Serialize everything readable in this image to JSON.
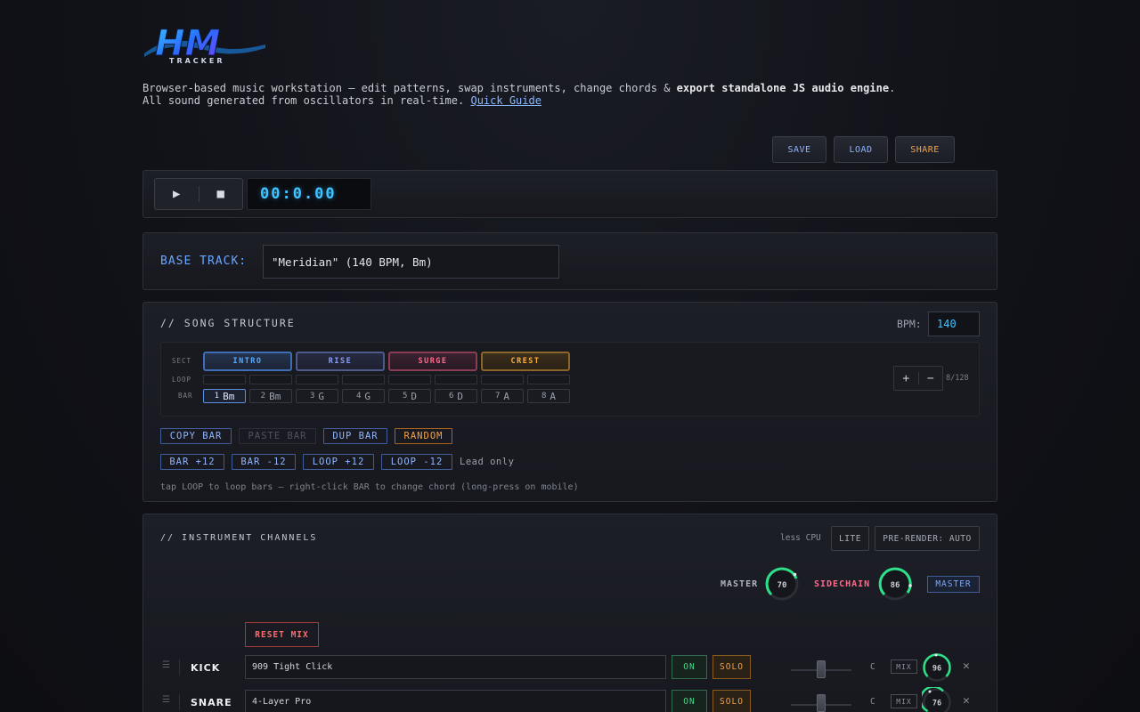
{
  "logo": {
    "main": "HM",
    "sub": "TRACKER"
  },
  "intro": {
    "line1_prefix": "Browser-based music workstation — edit patterns, swap instruments, change chords & ",
    "line1_bold": "export standalone JS audio engine",
    "line1_suffix": ".",
    "line2_prefix": "All sound generated from oscillators in real-time. ",
    "guide_link": "Quick Guide"
  },
  "top_actions": {
    "save": "SAVE",
    "load": "LOAD",
    "share": "SHARE"
  },
  "transport": {
    "play_icon": "▶",
    "stop_icon": "■",
    "time": "00:0.00"
  },
  "base_track": {
    "label": "BASE TRACK:",
    "value": "\"Meridian\" (140 BPM, Bm)"
  },
  "song": {
    "title": "// SONG STRUCTURE",
    "bpm_label": "BPM:",
    "bpm_value": "140",
    "row_labels": {
      "sect": "SECT",
      "loop": "LOOP",
      "bar": "BAR"
    },
    "sections": [
      {
        "label": "INTRO",
        "color": "#5aa8ff"
      },
      {
        "label": "RISE",
        "color": "#8a9cff"
      },
      {
        "label": "SURGE",
        "color": "#ff6a8a"
      },
      {
        "label": "CREST",
        "color": "#ffae3a"
      }
    ],
    "bars": [
      {
        "num": "1",
        "chord": "Bm"
      },
      {
        "num": "2",
        "chord": "Bm"
      },
      {
        "num": "3",
        "chord": "G"
      },
      {
        "num": "4",
        "chord": "G"
      },
      {
        "num": "5",
        "chord": "D"
      },
      {
        "num": "6",
        "chord": "D"
      },
      {
        "num": "7",
        "chord": "A"
      },
      {
        "num": "8",
        "chord": "A"
      }
    ],
    "plus": "+",
    "minus": "−",
    "bar_count": "8/128",
    "actions1": {
      "copy": "COPY BAR",
      "paste": "PASTE BAR",
      "dup": "DUP BAR",
      "random": "RANDOM"
    },
    "actions2": {
      "bar_up": "BAR +12",
      "bar_down": "BAR -12",
      "loop_up": "LOOP +12",
      "loop_down": "LOOP -12",
      "lead_only": "Lead only"
    },
    "hint": "tap LOOP to loop bars — right-click BAR to change chord (long-press on mobile)"
  },
  "instruments": {
    "title": "// INSTRUMENT CHANNELS",
    "cpu_label": "less CPU",
    "lite": "LITE",
    "prerender": "PRE-RENDER: AUTO",
    "master_label": "MASTER",
    "master_value": "70",
    "sidechain_label": "SIDECHAIN",
    "sidechain_value": "86",
    "master_btn": "MASTER",
    "reset_mix": "RESET MIX",
    "channels": [
      {
        "name": "KICK",
        "preset": "909 Tight Click",
        "on": "ON",
        "solo": "SOLO",
        "pan": "C",
        "mix": "MIX",
        "vol": "96",
        "close": "✕",
        "handle": "☰"
      },
      {
        "name": "SNARE",
        "preset": "4-Layer Pro",
        "on": "ON",
        "solo": "SOLO",
        "pan": "C",
        "mix": "MIX",
        "vol": "76",
        "close": "✕",
        "handle": "☰"
      }
    ]
  }
}
